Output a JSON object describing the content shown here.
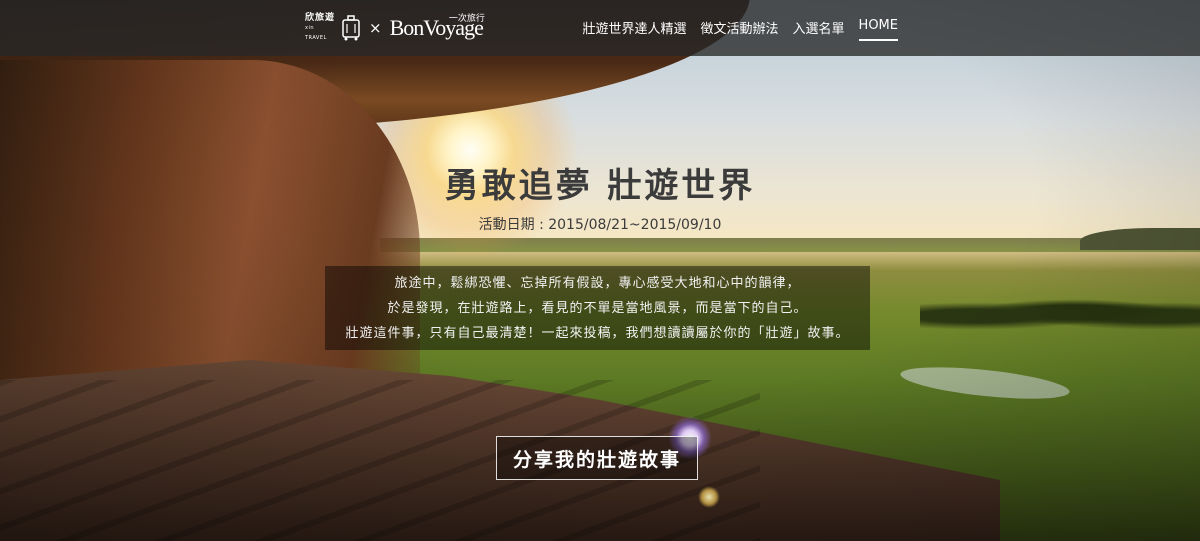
{
  "brand": {
    "partner_a_cn": "欣旅遊",
    "partner_a_en": "xin TRAVEL",
    "separator": "×",
    "partner_b_name": "BonVoyage",
    "partner_b_cn": "一次旅行",
    "suitcase_icon": "suitcase-icon"
  },
  "nav": {
    "items": [
      {
        "label": "壯遊世界達人精選"
      },
      {
        "label": "徵文活動辦法"
      },
      {
        "label": "入選名單"
      },
      {
        "label": "HOME"
      }
    ],
    "active": "HOME"
  },
  "hero": {
    "title": "勇敢追夢 壯遊世界",
    "date": "活動日期 : 2015/08/21~2015/09/10",
    "description": [
      "旅途中，鬆綁恐懼、忘掉所有假設，專心感受大地和心中的韻律，",
      "於是發現，在壯遊路上，看見的不單是當地風景，而是當下的自己。",
      "壯遊這件事，只有自己最清楚！一起來投稿，我們想讀讀屬於你的「壯遊」故事。"
    ],
    "cta_label": "分享我的壯遊故事"
  },
  "colors": {
    "navbar_bg": "#282828",
    "title_text": "#3b3b3b",
    "overlay_text": "#ffffff"
  }
}
